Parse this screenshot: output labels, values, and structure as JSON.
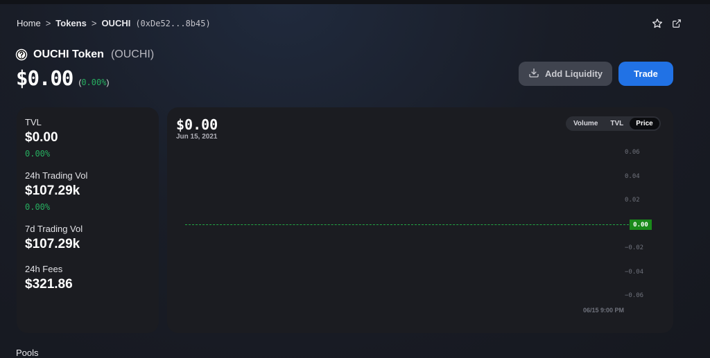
{
  "breadcrumb": {
    "home": "Home",
    "sep1": ">",
    "tokens": "Tokens",
    "sep2": ">",
    "current": "OUCHI",
    "address": "(0xDe52...8b45)"
  },
  "icons": {
    "star": "star-icon",
    "external": "external-link-icon",
    "token": "question-circle-icon",
    "download": "download-icon"
  },
  "token": {
    "name": "OUCHI Token",
    "symbol": "(OUCHI)",
    "price": "$0.00",
    "change_prefix": "(",
    "change": "0.00%",
    "change_suffix": ")"
  },
  "actions": {
    "add_liquidity": "Add Liquidity",
    "trade": "Trade"
  },
  "stats": [
    {
      "label": "TVL",
      "value": "$0.00",
      "change": "0.00%"
    },
    {
      "label": "24h Trading Vol",
      "value": "$107.29k",
      "change": "0.00%"
    },
    {
      "label": "7d Trading Vol",
      "value": "$107.29k"
    },
    {
      "label": "24h Fees",
      "value": "$321.86"
    }
  ],
  "chart": {
    "price": "$0.00",
    "date": "Jun 15, 2021",
    "toggles": [
      "Volume",
      "TVL",
      "Price"
    ],
    "active_toggle": "Price",
    "marker": "0.00",
    "x_label": "06/15 9:00 PM"
  },
  "chart_data": {
    "type": "line",
    "title": "",
    "xlabel": "",
    "ylabel": "",
    "x": [
      "06/15 9:00 PM"
    ],
    "series": [
      {
        "values": [
          0.0
        ]
      }
    ],
    "yticks": [
      "0.06",
      "0.04",
      "0.02",
      "0.00",
      "−0.02",
      "−0.04",
      "−0.06"
    ],
    "ylim": [
      -0.06,
      0.06
    ],
    "grid": false,
    "colors": {
      "line": "#23a845",
      "marker_bg": "#1a8a1a"
    }
  },
  "section": {
    "pools": "Pools"
  },
  "colors": {
    "accent": "#2172e5",
    "positive": "#27ae60",
    "card": "#1b1c21"
  }
}
